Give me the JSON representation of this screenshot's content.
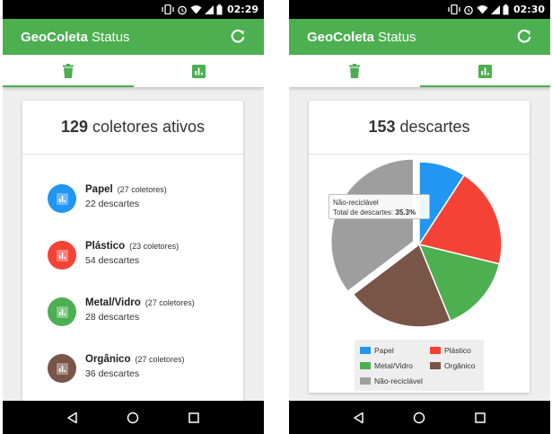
{
  "left": {
    "status_time": "02:29",
    "app_title_bold": "GeoColeta",
    "app_title_rest": "Status",
    "tabs": [
      {
        "icon": "trash-icon",
        "active": true
      },
      {
        "icon": "bar-chart-icon",
        "active": false
      }
    ],
    "summary_count": "129",
    "summary_label": "coletores ativos",
    "items": [
      {
        "name": "Papel",
        "collectors": "(27 coletores)",
        "discards": "22 descartes",
        "color": "#2196f3"
      },
      {
        "name": "Plástico",
        "collectors": "(23 coletores)",
        "discards": "54 descartes",
        "color": "#f44336"
      },
      {
        "name": "Metal/Vidro",
        "collectors": "(27 coletores)",
        "discards": "28 descartes",
        "color": "#4caf50"
      },
      {
        "name": "Orgânico",
        "collectors": "(27 coletores)",
        "discards": "36 descartes",
        "color": "#795548"
      }
    ]
  },
  "right": {
    "status_time": "02:30",
    "app_title_bold": "GeoColeta",
    "app_title_rest": "Status",
    "summary_count": "153",
    "summary_label": "descartes",
    "tooltip": {
      "title": "Não-reciclável",
      "label": "Total de descartes:",
      "value": "35.3%"
    },
    "chart_data": {
      "type": "pie",
      "title": "",
      "categories": [
        "Papel",
        "Plástico",
        "Metal/Vidro",
        "Orgânico",
        "Não-reciclável"
      ],
      "values": [
        9.2,
        19.6,
        15.0,
        20.9,
        35.3
      ],
      "unit": "%",
      "colors": [
        "#2196f3",
        "#f44336",
        "#4caf50",
        "#795548",
        "#9e9e9e"
      ],
      "highlighted": "Não-reciclável",
      "legend_placement": "bottom"
    }
  }
}
